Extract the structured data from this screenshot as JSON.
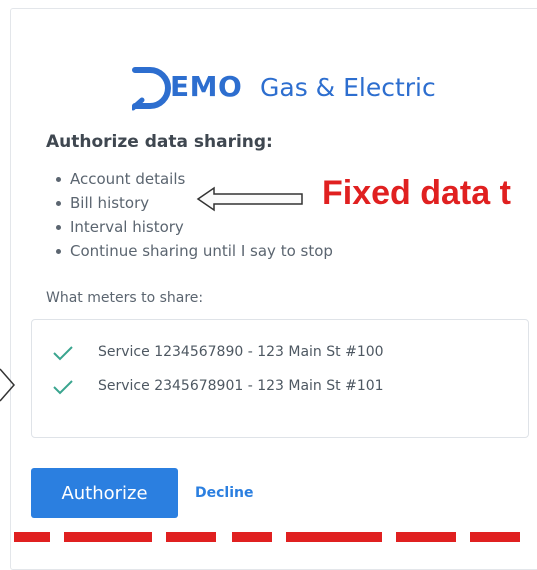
{
  "brand": {
    "logo_initial": "D",
    "logo_emo": "EMO",
    "logo_rest": "Gas & Electric",
    "color": "#2d6ecf"
  },
  "authorize": {
    "title": "Authorize data sharing:",
    "items": [
      "Account details",
      "Bill history",
      "Interval history",
      "Continue sharing until I say to stop"
    ]
  },
  "meters": {
    "label": "What meters to share:",
    "rows": [
      {
        "text": "Service 1234567890 - 123 Main St #100",
        "checked": true
      },
      {
        "text": "Service 2345678901 - 123 Main St #101",
        "checked": true
      }
    ],
    "check_color": "#3aa58f"
  },
  "actions": {
    "authorize_label": "Authorize",
    "decline_label": "Decline",
    "accent": "#2b7fe0"
  },
  "annotation": {
    "text": "Fixed data t",
    "color": "#e02020"
  }
}
